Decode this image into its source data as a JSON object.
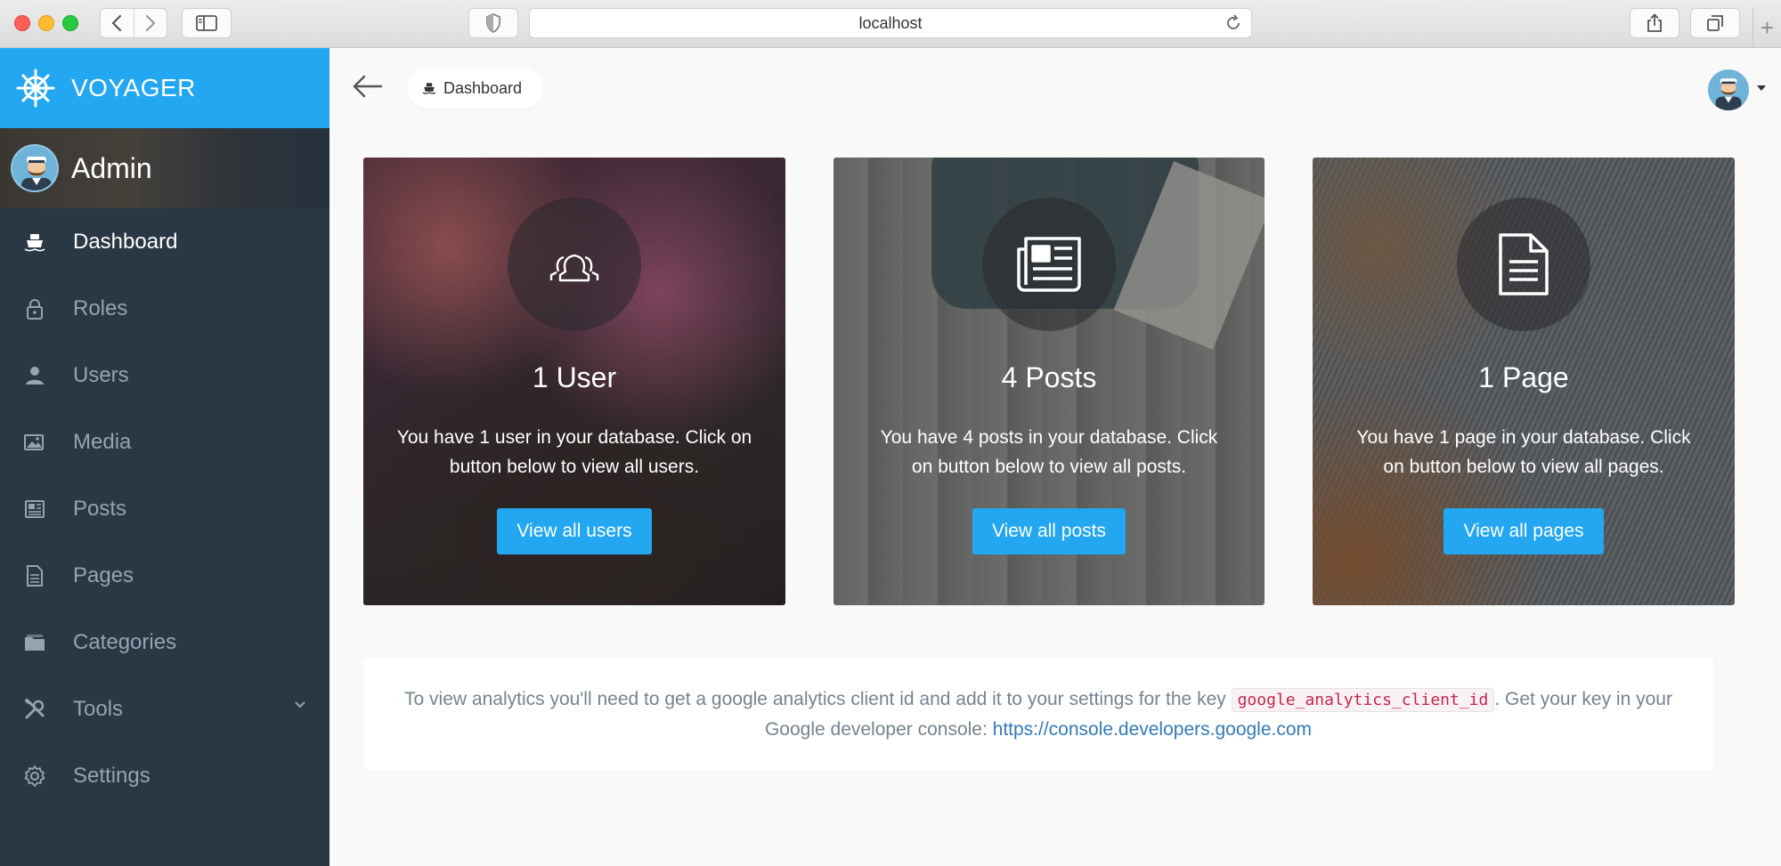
{
  "browser": {
    "url": "localhost"
  },
  "sidebar": {
    "brand": "VOYAGER",
    "user_name": "Admin",
    "items": [
      {
        "label": "Dashboard",
        "icon": "boat-icon",
        "active": true
      },
      {
        "label": "Roles",
        "icon": "lock-icon"
      },
      {
        "label": "Users",
        "icon": "person-icon"
      },
      {
        "label": "Media",
        "icon": "image-icon"
      },
      {
        "label": "Posts",
        "icon": "news-icon"
      },
      {
        "label": "Pages",
        "icon": "file-icon"
      },
      {
        "label": "Categories",
        "icon": "folder-icon"
      },
      {
        "label": "Tools",
        "icon": "tools-icon",
        "has_children": true
      },
      {
        "label": "Settings",
        "icon": "gear-icon"
      }
    ]
  },
  "header": {
    "breadcrumb": "Dashboard"
  },
  "cards": [
    {
      "title": "1 User",
      "text": "You have 1 user in your database. Click on button below to view all users.",
      "button": "View all users",
      "icon": "group-icon"
    },
    {
      "title": "4 Posts",
      "text": "You have 4 posts in your database. Click on button below to view all posts.",
      "button": "View all posts",
      "icon": "newspaper-icon"
    },
    {
      "title": "1 Page",
      "text": "You have 1 page in your database. Click on button below to view all pages.",
      "button": "View all pages",
      "icon": "document-icon"
    }
  ],
  "analytics": {
    "text_before": "To view analytics you'll need to get a google analytics client id and add it to your settings for the key ",
    "code": "google_analytics_client_id",
    "text_after": ". Get your key in your Google developer console: ",
    "link": "https://console.developers.google.com"
  },
  "colors": {
    "accent": "#22a7f0",
    "sidebar_bg": "#2a3745",
    "sidebar_text": "#96a3b0"
  }
}
